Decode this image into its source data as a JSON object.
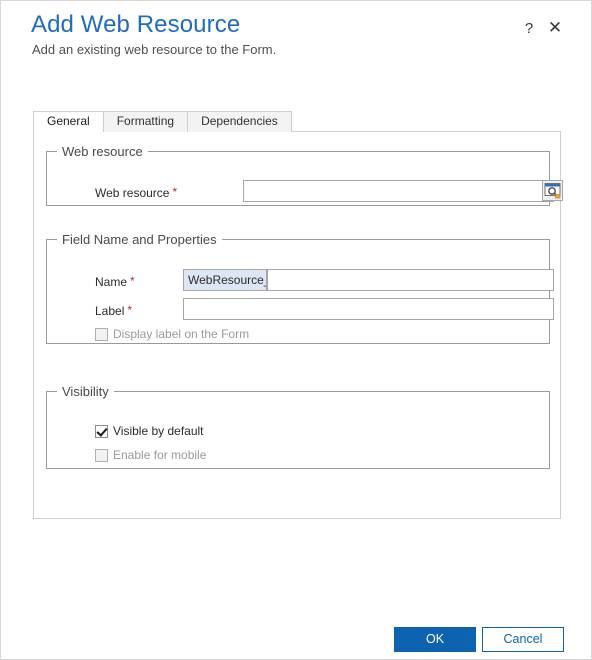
{
  "dialog": {
    "title": "Add Web Resource",
    "subtitle": "Add an existing web resource to the Form.",
    "help_icon_label": "?",
    "close_icon_label": "✕"
  },
  "tabs": [
    {
      "label": "General",
      "active": true
    },
    {
      "label": "Formatting",
      "active": false
    },
    {
      "label": "Dependencies",
      "active": false
    }
  ],
  "groups": {
    "web_resource": {
      "legend": "Web resource",
      "field": {
        "label": "Web resource",
        "required_marker": "*",
        "value": "",
        "placeholder": ""
      },
      "lookup_button_title": "Browse"
    },
    "field_name_and_properties": {
      "legend": "Field Name and Properties",
      "name": {
        "label": "Name",
        "required_marker": "*",
        "prefix": "WebResource_",
        "value": "",
        "placeholder": ""
      },
      "label_field": {
        "label": "Label",
        "required_marker": "*",
        "value": "",
        "placeholder": ""
      },
      "display_label_checkbox": {
        "label": "Display label on the Form",
        "checked": false,
        "disabled": true
      }
    },
    "visibility": {
      "legend": "Visibility",
      "visible_by_default": {
        "label": "Visible by default",
        "checked": true,
        "disabled": false
      },
      "enable_for_mobile": {
        "label": "Enable for mobile",
        "checked": false,
        "disabled": true
      }
    }
  },
  "footer": {
    "ok_label": "OK",
    "cancel_label": "Cancel"
  },
  "colors": {
    "title_blue": "#1f6cc4",
    "primary_button": "#0e63b0",
    "required_red": "#c0262b",
    "prefix_background": "#dce6f4"
  }
}
